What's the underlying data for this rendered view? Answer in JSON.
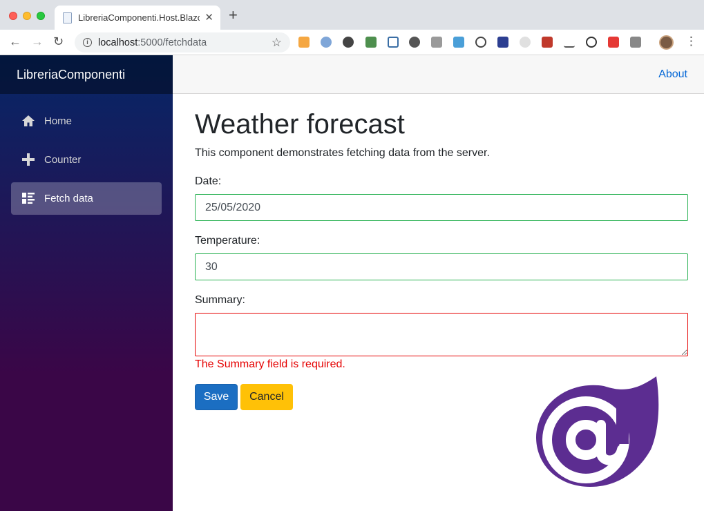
{
  "browser": {
    "tab_title": "LibreriaComponenti.Host.Blazo",
    "tab_close": "✕",
    "new_tab": "+",
    "url_host": "localhost",
    "url_path": ":5000/fetchdata"
  },
  "app": {
    "brand": "LibreriaComponenti",
    "about": "About"
  },
  "sidebar": {
    "items": [
      {
        "label": "Home",
        "icon": "home-icon",
        "active": false
      },
      {
        "label": "Counter",
        "icon": "plus-icon",
        "active": false
      },
      {
        "label": "Fetch data",
        "icon": "list-icon",
        "active": true
      }
    ]
  },
  "page": {
    "title": "Weather forecast",
    "description": "This component demonstrates fetching data from the server."
  },
  "form": {
    "date_label": "Date:",
    "date_value": "25/05/2020",
    "temperature_label": "Temperature:",
    "temperature_value": "30",
    "summary_label": "Summary:",
    "summary_value": "",
    "summary_error": "The Summary field is required.",
    "save_label": "Save",
    "cancel_label": "Cancel"
  },
  "colors": {
    "primary": "#1b6ec2",
    "warning": "#ffc107",
    "valid": "#26b050",
    "invalid": "#e50000",
    "link": "#0366d6",
    "blazor_purple": "#5c2d91"
  }
}
